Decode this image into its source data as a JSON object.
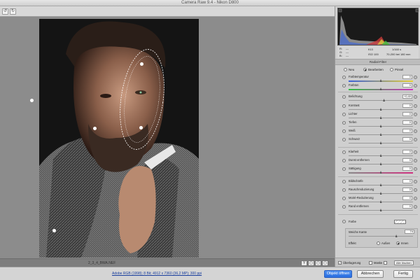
{
  "window": {
    "title": "Camera Raw 9.4 - Nikon D800"
  },
  "toolbar": {
    "rotate_left": "↺",
    "rotate_right": "↻"
  },
  "preview": {
    "zoom_label": "2_3_4_BWA.NEF",
    "view_buttons": [
      "Y",
      "▢",
      "▢",
      "▢"
    ]
  },
  "exif": {
    "r": "R:",
    "g": "G:",
    "b": "B:",
    "r_val": "---",
    "g_val": "---",
    "b_val": "---",
    "aperture": "f/13",
    "shutter": "1/160 s",
    "iso": "ISO 100",
    "lens": "70-200 bei 180 mm"
  },
  "panel": {
    "header": "Radial-Filter",
    "modes": [
      {
        "label": "Neu",
        "selected": false
      },
      {
        "label": "Bearbeiten",
        "selected": true
      },
      {
        "label": "Pinsel",
        "selected": false
      }
    ],
    "sliders": [
      {
        "label": "Farbtemperatur",
        "value": "0",
        "pos": 0.5,
        "track": "grad-temp"
      },
      {
        "label": "Farbton",
        "value": "0",
        "pos": 0.5,
        "track": "grad-tint"
      },
      {
        "label": "Belichtung",
        "value": "+0,40",
        "pos": 0.55,
        "track": ""
      },
      {
        "label": "Kontrast",
        "value": "0",
        "pos": 0.5,
        "track": ""
      },
      {
        "label": "Lichter",
        "value": "0",
        "pos": 0.5,
        "track": ""
      },
      {
        "label": "Tiefen",
        "value": "0",
        "pos": 0.5,
        "track": ""
      },
      {
        "label": "Weiß",
        "value": "0",
        "pos": 0.5,
        "track": ""
      },
      {
        "label": "Schwarz",
        "value": "0",
        "pos": 0.5,
        "track": ""
      },
      {
        "label": "Klarheit",
        "value": "0",
        "pos": 0.5,
        "track": ""
      },
      {
        "label": "Dunst entfernen",
        "value": "0",
        "pos": 0.5,
        "track": ""
      },
      {
        "label": "Sättigung",
        "value": "0",
        "pos": 0.5,
        "track": "grad-sat"
      },
      {
        "label": "Bildschärfe",
        "value": "0",
        "pos": 0.5,
        "track": ""
      },
      {
        "label": "Rauschreduzierung",
        "value": "0",
        "pos": 0.5,
        "track": ""
      },
      {
        "label": "Moiré-Reduzierung",
        "value": "0",
        "pos": 0.5,
        "track": ""
      },
      {
        "label": "Rand entfernen",
        "value": "0",
        "pos": 0.5,
        "track": ""
      }
    ],
    "color_label": "Farbe",
    "feather_label": "Weiche Kante",
    "feather_value": "74",
    "feather_pos": 0.74,
    "effect_label": "Effekt",
    "effect_options": [
      {
        "label": "Außen",
        "selected": false
      },
      {
        "label": "Innen",
        "selected": true
      }
    ],
    "overlay_label": "Überlagerung",
    "overlay_checked": true,
    "mask_label": "Maske",
    "mask_checked": false,
    "clear_all": "Alle löschen"
  },
  "bottom": {
    "workflow_link": "Adobe RGB (1998); 8 Bit; 4912 x 7360 (36,2 MP); 300 ppi",
    "open_button": "Objekt öffnen",
    "cancel_button": "Abbrechen",
    "done_button": "Fertig"
  }
}
